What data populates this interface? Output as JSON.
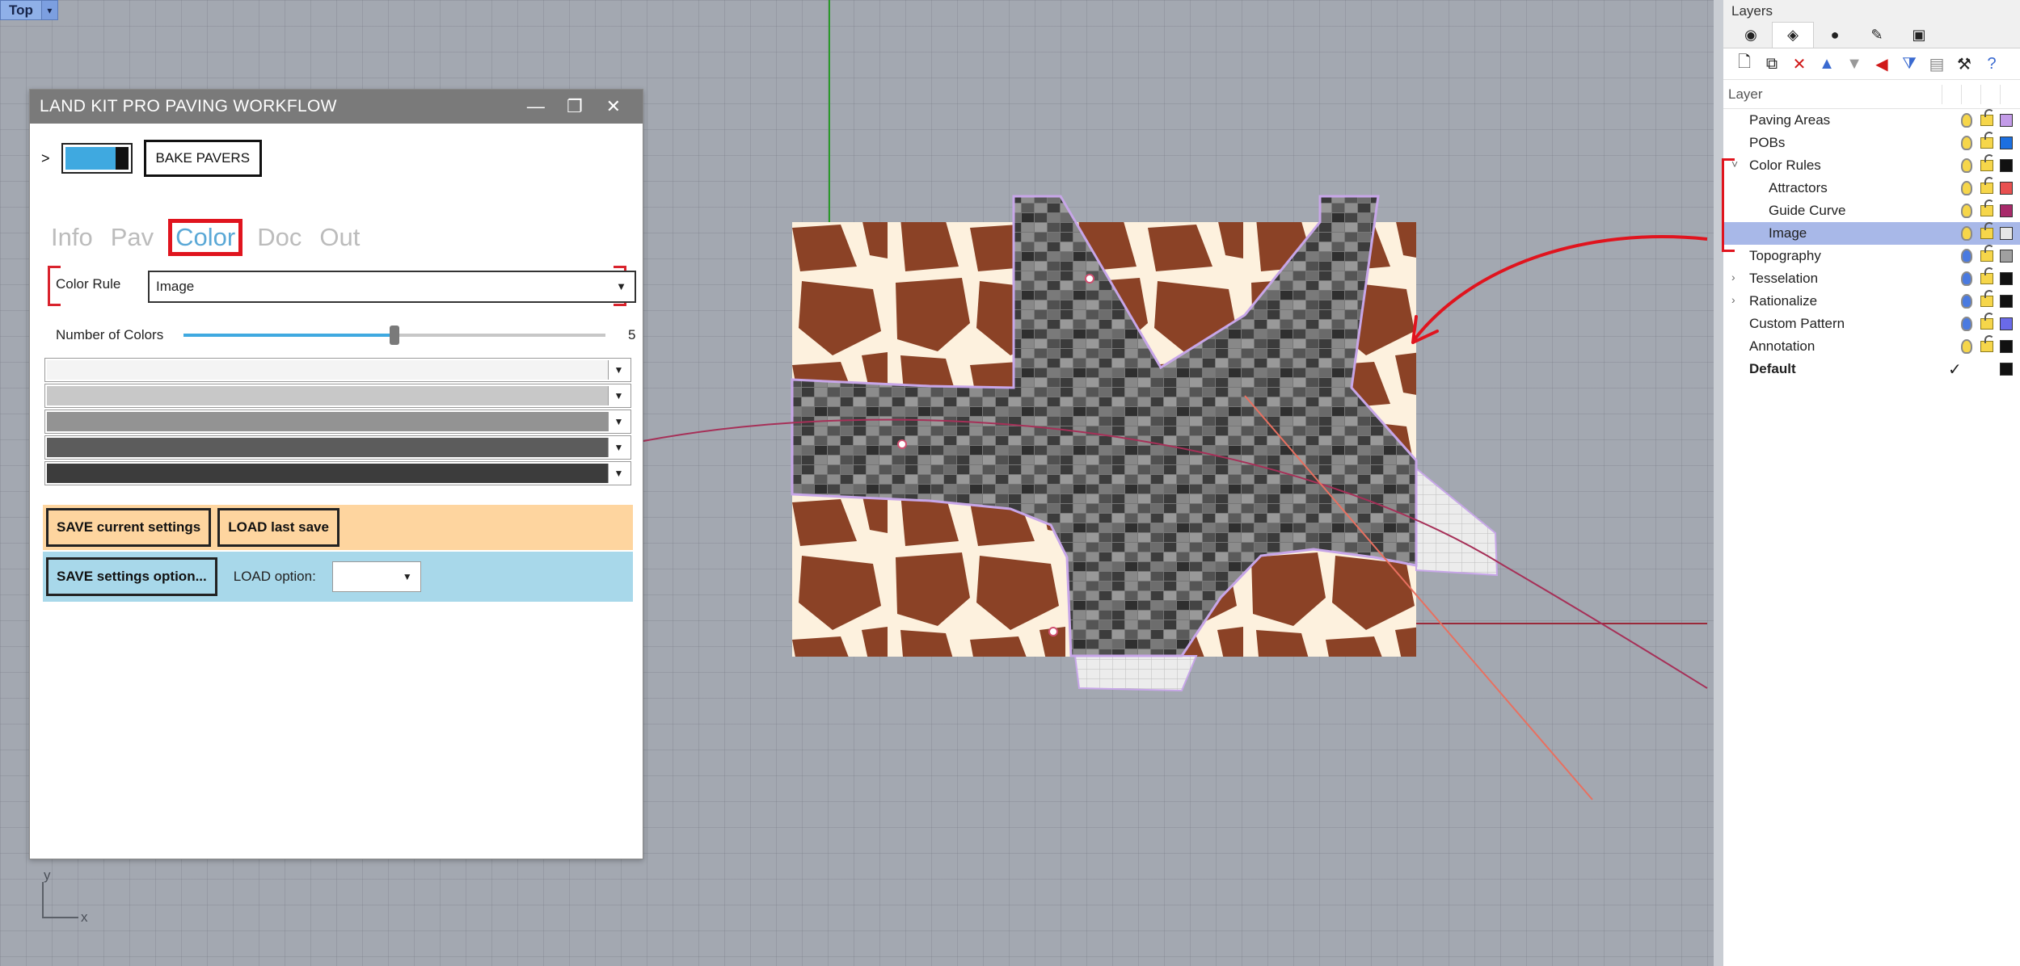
{
  "viewport": {
    "label": "Top",
    "axis_y": "y",
    "axis_x": "x"
  },
  "plugin": {
    "title": "LAND KIT PRO PAVING WORKFLOW",
    "expander": ">",
    "bake_label": "BAKE PAVERS",
    "toggle_color": "#3fa9e0",
    "tabs": [
      {
        "label": "Info",
        "active": false
      },
      {
        "label": "Pav",
        "active": false
      },
      {
        "label": "Color",
        "active": true
      },
      {
        "label": "Doc",
        "active": false
      },
      {
        "label": "Out",
        "active": false
      }
    ],
    "color_rule": {
      "label": "Color Rule",
      "value": "Image"
    },
    "number_of_colors": {
      "label": "Number of Colors",
      "value": "5",
      "slider_fraction": 0.5
    },
    "color_swatches": [
      "#f4f4f4",
      "#c8c8c8",
      "#939393",
      "#5c5c5c",
      "#3c3c3c"
    ],
    "save_current": "SAVE current settings",
    "load_last": "LOAD last save",
    "save_option": "SAVE settings option...",
    "load_option_label": "LOAD option:",
    "load_option_value": ""
  },
  "layers": {
    "panel_title": "Layers",
    "column_header": "Layer",
    "rows": [
      {
        "name": "Paving Areas",
        "level": 0,
        "expander": "",
        "bulb": "#f6d64a",
        "color": "#c39be8",
        "selected": false
      },
      {
        "name": "POBs",
        "level": 0,
        "expander": "",
        "bulb": "#f6d64a",
        "color": "#1c6fe0",
        "selected": false
      },
      {
        "name": "Color Rules",
        "level": 0,
        "expander": "˅",
        "bulb": "#f6d64a",
        "color": "#111111",
        "selected": false
      },
      {
        "name": "Attractors",
        "level": 1,
        "expander": "",
        "bulb": "#f6d64a",
        "color": "#e85050",
        "selected": false
      },
      {
        "name": "Guide Curve",
        "level": 1,
        "expander": "",
        "bulb": "#f6d64a",
        "color": "#a82a6a",
        "selected": false
      },
      {
        "name": "Image",
        "level": 1,
        "expander": "",
        "bulb": "#f6d64a",
        "color": "#e6e6e6",
        "selected": true
      },
      {
        "name": "Topography",
        "level": 0,
        "expander": "",
        "bulb": "#4a7ae0",
        "color": "#a0a0a0",
        "selected": false
      },
      {
        "name": "Tesselation",
        "level": 0,
        "expander": "›",
        "bulb": "#4a7ae0",
        "color": "#111111",
        "selected": false
      },
      {
        "name": "Rationalize",
        "level": 0,
        "expander": "›",
        "bulb": "#4a7ae0",
        "color": "#111111",
        "selected": false
      },
      {
        "name": "Custom Pattern",
        "level": 0,
        "expander": "",
        "bulb": "#4a7ae0",
        "color": "#6a6ae8",
        "selected": false
      },
      {
        "name": "Annotation",
        "level": 0,
        "expander": "",
        "bulb": "#f6d64a",
        "color": "#111111",
        "selected": false
      },
      {
        "name": "Default",
        "level": 0,
        "expander": "",
        "bulb": "",
        "color": "#111111",
        "selected": false,
        "current": true,
        "check": "✓"
      }
    ]
  },
  "colors": {
    "giraffe_brown": "#8b4226",
    "giraffe_cream": "#fdf1de",
    "paver_dark": "#3f3f3f",
    "paver_mid": "#777777",
    "outline": "#c7a6e8",
    "curve": "#a63058",
    "annotation_red": "#e0141e"
  }
}
